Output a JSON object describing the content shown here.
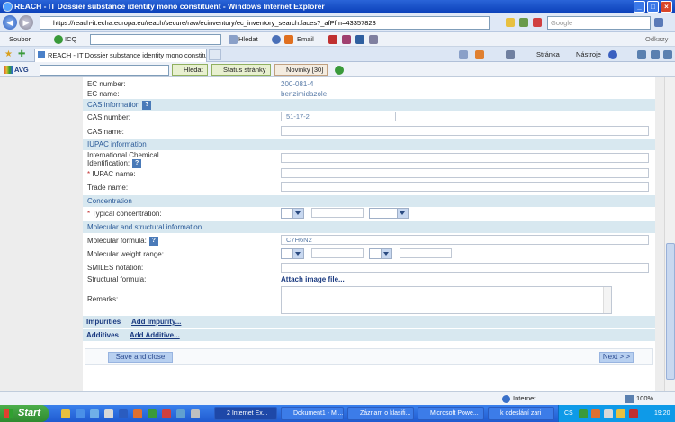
{
  "window": {
    "title": "REACH - IT Dossier substance identity mono constituent - Windows Internet Explorer"
  },
  "addressbar": {
    "url": "https://reach-it.echa.europa.eu/reach/secure/raw/ecinventory/ec_inventory_search.faces?_afPfm=43357823",
    "search_placeholder": "Google"
  },
  "menubar": {
    "soubor": "Soubor",
    "icq": "ICQ",
    "hledat": "Hledat",
    "email": "Email",
    "odkazy": "Odkazy"
  },
  "tabs": {
    "active": "REACH - IT Dossier substance identity mono constituent"
  },
  "cmdbar": {
    "stranka": "Stránka",
    "nastroje": "Nástroje"
  },
  "avgbar": {
    "avg": "AVG",
    "hledat": "Hledat",
    "status": "Status stránky",
    "novinky": "Novinky [30]"
  },
  "form": {
    "ec_number_label": "EC number:",
    "ec_number_value": "200-081-4",
    "ec_name_label": "EC name:",
    "ec_name_value": "benzimidazole",
    "cas_section": "CAS information",
    "cas_number_label": "CAS number:",
    "cas_number_value": "51-17-2",
    "cas_name_label": "CAS name:",
    "iupac_section": "IUPAC information",
    "intl_chem_label_1": "International Chemical",
    "intl_chem_label_2": "Identification:",
    "iupac_name_label": "IUPAC name:",
    "trade_name_label": "Trade name:",
    "conc_section": "Concentration",
    "typical_conc_label": "Typical concentration:",
    "mol_section": "Molecular and structural information",
    "mol_formula_label": "Molecular formula:",
    "mol_formula_value": "C7H6N2",
    "mol_weight_label": "Molecular weight range:",
    "smiles_label": "SMILES notation:",
    "struct_formula_label": "Structural formula:",
    "attach_link": "Attach image file...",
    "remarks_label": "Remarks:",
    "impurities_label": "Impurities",
    "add_impurity": "Add Impurity...",
    "additives_label": "Additives",
    "add_additive": "Add Additive...",
    "save_button": "Save and close",
    "next_button": "Next > >"
  },
  "statusbar": {
    "zone": "Internet",
    "zoom": "100%"
  },
  "taskbar": {
    "start": "Start",
    "items": [
      "2 Internet Ex...",
      "Dokument1 - Mi...",
      "Záznam o klasifi...",
      "Microsoft Powe...",
      "k odeslání zari"
    ],
    "lang": "CS",
    "clock": "19:20"
  }
}
